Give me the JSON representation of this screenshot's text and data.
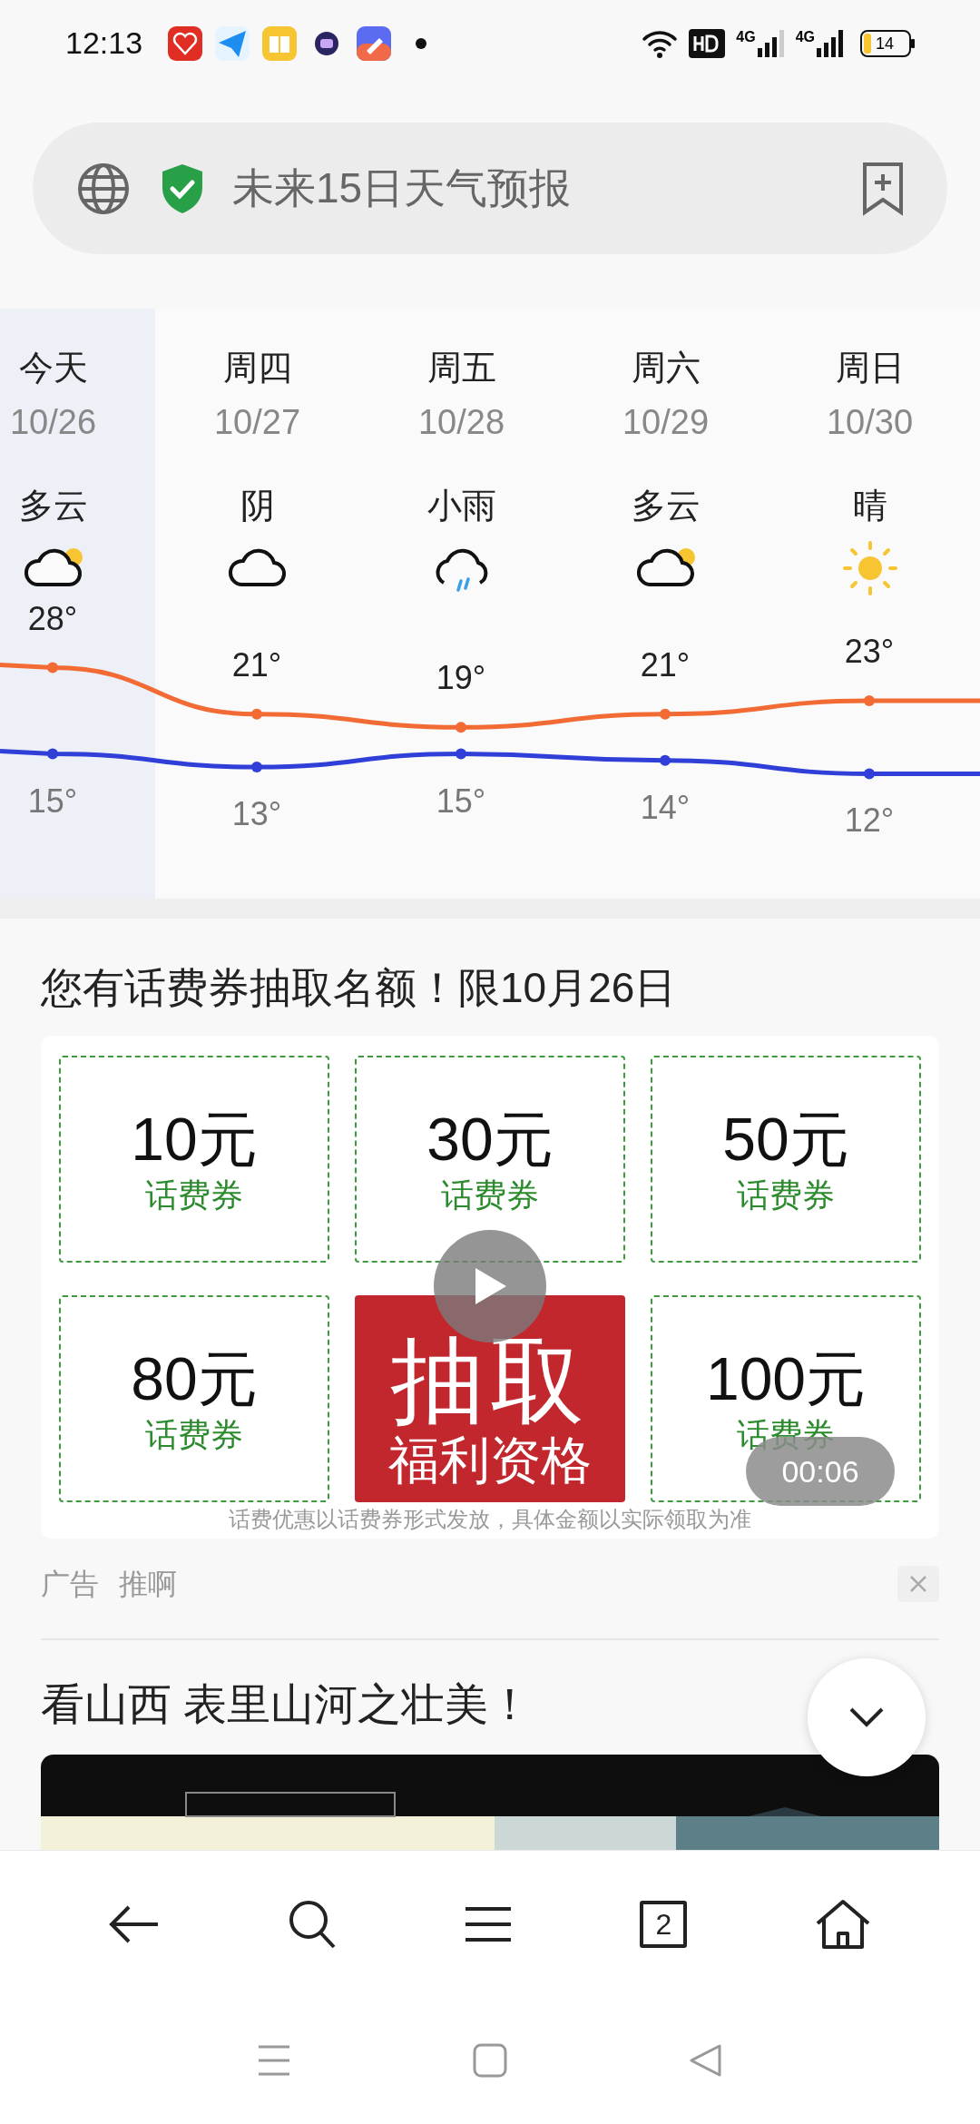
{
  "status_bar": {
    "time": "12:13",
    "network_labels": [
      "4G",
      "4G"
    ],
    "battery": "14"
  },
  "address_bar": {
    "title": "未来15日天气预报"
  },
  "weather": {
    "days": [
      {
        "day": "今天",
        "date": "10/26",
        "condition": "多云",
        "kind": "partly_cloudy",
        "high": "28°",
        "low": "15°",
        "selected": true
      },
      {
        "day": "周四",
        "date": "10/27",
        "condition": "阴",
        "kind": "cloudy",
        "high": "21°",
        "low": "13°",
        "selected": false
      },
      {
        "day": "周五",
        "date": "10/28",
        "condition": "小雨",
        "kind": "rain",
        "high": "19°",
        "low": "15°",
        "selected": false
      },
      {
        "day": "周六",
        "date": "10/29",
        "condition": "多云",
        "kind": "partly_cloudy",
        "high": "21°",
        "low": "14°",
        "selected": false
      },
      {
        "day": "周日",
        "date": "10/30",
        "condition": "晴",
        "kind": "sunny",
        "high": "23°",
        "low": "12°",
        "selected": false
      }
    ]
  },
  "ad": {
    "title": "您有话费券抽取名额！限10月26日",
    "tiles": [
      {
        "kind": "coupon",
        "amount": "10元",
        "label": "话费券"
      },
      {
        "kind": "coupon",
        "amount": "30元",
        "label": "话费券"
      },
      {
        "kind": "coupon",
        "amount": "50元",
        "label": "话费券"
      },
      {
        "kind": "coupon",
        "amount": "80元",
        "label": "话费券"
      },
      {
        "kind": "draw",
        "amount": "抽取",
        "label": "福利资格"
      },
      {
        "kind": "coupon",
        "amount": "100元",
        "label": "话费券"
      }
    ],
    "disclaimer": "话费优惠以话费券形式发放，具体金额以实际领取为准",
    "timer": "00:06",
    "source": [
      "广告",
      "推啊"
    ]
  },
  "article": {
    "title": "看山西 表里山河之壮美！"
  },
  "toolbar": {
    "tab_count": "2"
  }
}
